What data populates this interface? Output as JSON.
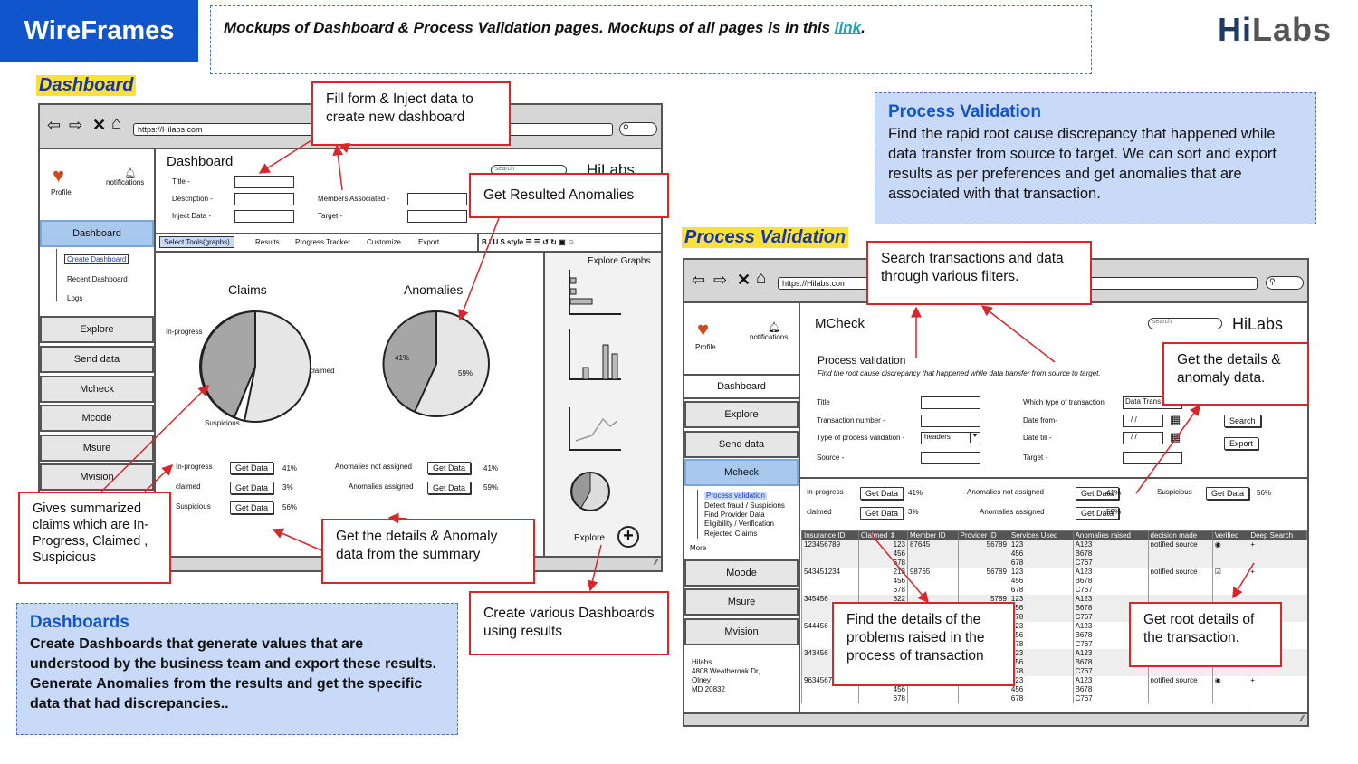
{
  "header": {
    "title": "WireFrames",
    "intro_text": "Mockups of Dashboard & Process Validation pages. Mockups of all pages is in this ",
    "intro_link": "link",
    "intro_end": ".",
    "logo_hi": "Hi",
    "logo_labs": "Labs"
  },
  "dashboard": {
    "section_label": "Dashboard",
    "url": "https://Hilabs.com",
    "profile": "Profile",
    "notifications": "notifications",
    "page_title": "Dashboard",
    "search_placeholder": "search",
    "brand": "HiLabs",
    "fields": {
      "title": "Title -",
      "description": "Description -",
      "inject": "Inject Data -",
      "members": "Members Associated -",
      "target": "Target -"
    },
    "nav": {
      "dashboard": "Dashboard",
      "sub": [
        "Create Dashboard",
        "Recent Dashboard",
        "Logs"
      ],
      "explore": "Explore",
      "send": "Send data",
      "mcheck": "Mcheck",
      "mcode": "Mcode",
      "msure": "Msure",
      "mvision": "Mvision"
    },
    "tabs": [
      "Select Tools(graphs)",
      "Results",
      "Progress Tracker",
      "Customize",
      "Export"
    ],
    "format_tools": "B I U S style ☰ ☰ ↺ ↻ ▣ ☺",
    "claims": {
      "title": "Claims",
      "in_progress": "In-progress",
      "claimed": "claimed",
      "suspicious": "Suspicious"
    },
    "anomalies": {
      "title": "Anomalies",
      "pct_a": "41%",
      "pct_b": "59%"
    },
    "summary_left": [
      {
        "label": "In-progress",
        "btn": "Get Data",
        "pct": "41%"
      },
      {
        "label": "claimed",
        "btn": "Get Data",
        "pct": "3%"
      },
      {
        "label": "Suspicious",
        "btn": "Get Data",
        "pct": "56%"
      }
    ],
    "summary_right": [
      {
        "label": "Anomalies not assigned",
        "btn": "Get Data",
        "pct": "41%"
      },
      {
        "label": "Anomalies assigned",
        "btn": "Get Data",
        "pct": "59%"
      }
    ],
    "explore_graphs": "Explore Graphs",
    "explore": "Explore"
  },
  "callouts": {
    "fill_form": "Fill form & Inject data to create new dashboard",
    "resulted": "Get Resulted Anomalies",
    "summarized": "Gives summarized claims which are In-Progress, Claimed , Suspicious",
    "details": "Get the details & Anomaly data from the summary",
    "create": "Create various Dashboards using results",
    "search": "Search transactions and data through various filters.",
    "anomaly_details": "Get the details & anomaly data.",
    "problems": "Find the details of the problems raised in the process of transaction",
    "root": "Get root details of the transaction."
  },
  "dashboards_box": {
    "title": "Dashboards",
    "text": "Create Dashboards that generate values that are understood by the business team and export these results. Generate Anomalies from the results and get the specific data that had discrepancies.."
  },
  "pv_box": {
    "title": "Process Validation",
    "text": "Find the rapid root cause discrepancy that happened while data transfer from source to target. We can sort and export results as per preferences and get anomalies that are associated with that transaction."
  },
  "pv": {
    "section_label": "Process Validation",
    "url": "https://Hilabs.com",
    "page_title": "MCheck",
    "profile": "Profile",
    "notifications": "notifications",
    "search_placeholder": "search",
    "brand": "HiLabs",
    "heading": "Process validation",
    "subheading": "Find the root cause discrepancy that happened while data transfer from source to target.",
    "fields": {
      "title": "Title",
      "txn": "Transaction number -",
      "type": "Type of process validation -",
      "type_val": "headers",
      "source": "Source -",
      "which": "Which type of transaction",
      "which_val": "Data Trans",
      "from": "Date from-",
      "till": "Date till -",
      "target": "Target -",
      "date_ph": "/ /"
    },
    "search_btn": "Search",
    "export_btn": "Export",
    "nav": {
      "dashboard": "Dashboard",
      "explore": "Explore",
      "send": "Send data",
      "mcheck": "Mcheck",
      "sub": [
        "Process validation",
        "Detect fraud / Suspicions",
        "Find Provider Data",
        "Eligibility / Verification",
        "Rejected Claims"
      ],
      "more": "More",
      "moode": "Moode",
      "msure": "Msure",
      "mvision": "Mvision"
    },
    "address": [
      "Hilabs",
      "4808 Weatheroak Dr,",
      "Olney",
      "MD 20832"
    ],
    "summary": {
      "inprog": "In-progress",
      "claimed": "claimed",
      "btn": "Get Data",
      "p1": "41%",
      "p2": "3%",
      "not_assigned": "Anomalies not assigned",
      "assigned": "Anomalies assigned",
      "p3": "41%",
      "p4": "59%",
      "susp": "Suspicious",
      "p5": "56%"
    },
    "table": {
      "headers": [
        "Insurance ID",
        "Claimed ⇕",
        "Member ID",
        "Provider ID",
        "Services Used",
        "Anomalies raised",
        "decision made",
        "Verified",
        "Deep Search"
      ],
      "rows": [
        [
          "123456789",
          "123\n456\n678",
          "87645",
          "56789",
          "123\n456\n678",
          "A123\nB678\nC767",
          "notified source",
          "◉",
          "+"
        ],
        [
          "543451234",
          "213\n456\n678",
          "98765",
          "56789",
          "123\n456\n678",
          "A123\nB678\nC767",
          "notified source",
          "☑",
          "+"
        ],
        [
          "345456",
          "822",
          "",
          "5789",
          "123\n456\n678",
          "A123\nB678\nC767",
          "",
          "",
          ""
        ],
        [
          "544456",
          "",
          "",
          "5789",
          "123\n456\n678",
          "A123\nB678\nC767",
          "",
          "",
          ""
        ],
        [
          "343456",
          "",
          "",
          "5789",
          "123\n456\n678",
          "A123\nB678\nC767",
          "notified source",
          "◉",
          "+"
        ],
        [
          "963456789",
          "023\n456\n678",
          "98765",
          "56789",
          "123\n456\n678",
          "A123\nB678\nC767",
          "notified source",
          "◉",
          "+"
        ]
      ]
    }
  }
}
